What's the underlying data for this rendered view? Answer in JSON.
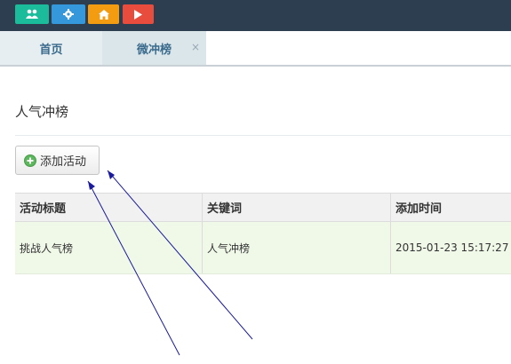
{
  "toolbar": {
    "buttons": [
      {
        "icon": "users-icon",
        "color": "#1abc9c"
      },
      {
        "icon": "gear-icon",
        "color": "#3498db"
      },
      {
        "icon": "home-icon",
        "color": "#f39c12"
      },
      {
        "icon": "play-icon",
        "color": "#e74c3c"
      }
    ]
  },
  "tabs": {
    "home": "首页",
    "active": "微冲榜",
    "close": "×"
  },
  "page": {
    "title": "人气冲榜",
    "add_button": "添加活动"
  },
  "table": {
    "headers": [
      "活动标题",
      "关键词",
      "添加时间"
    ],
    "rows": [
      [
        "挑战人气榜",
        "人气冲榜",
        "2015-01-23 15:17:27"
      ]
    ]
  },
  "colors": {
    "topbar": "#2c3e50",
    "row_highlight": "#f0f9e8",
    "arrow": "#1a1a9e"
  }
}
